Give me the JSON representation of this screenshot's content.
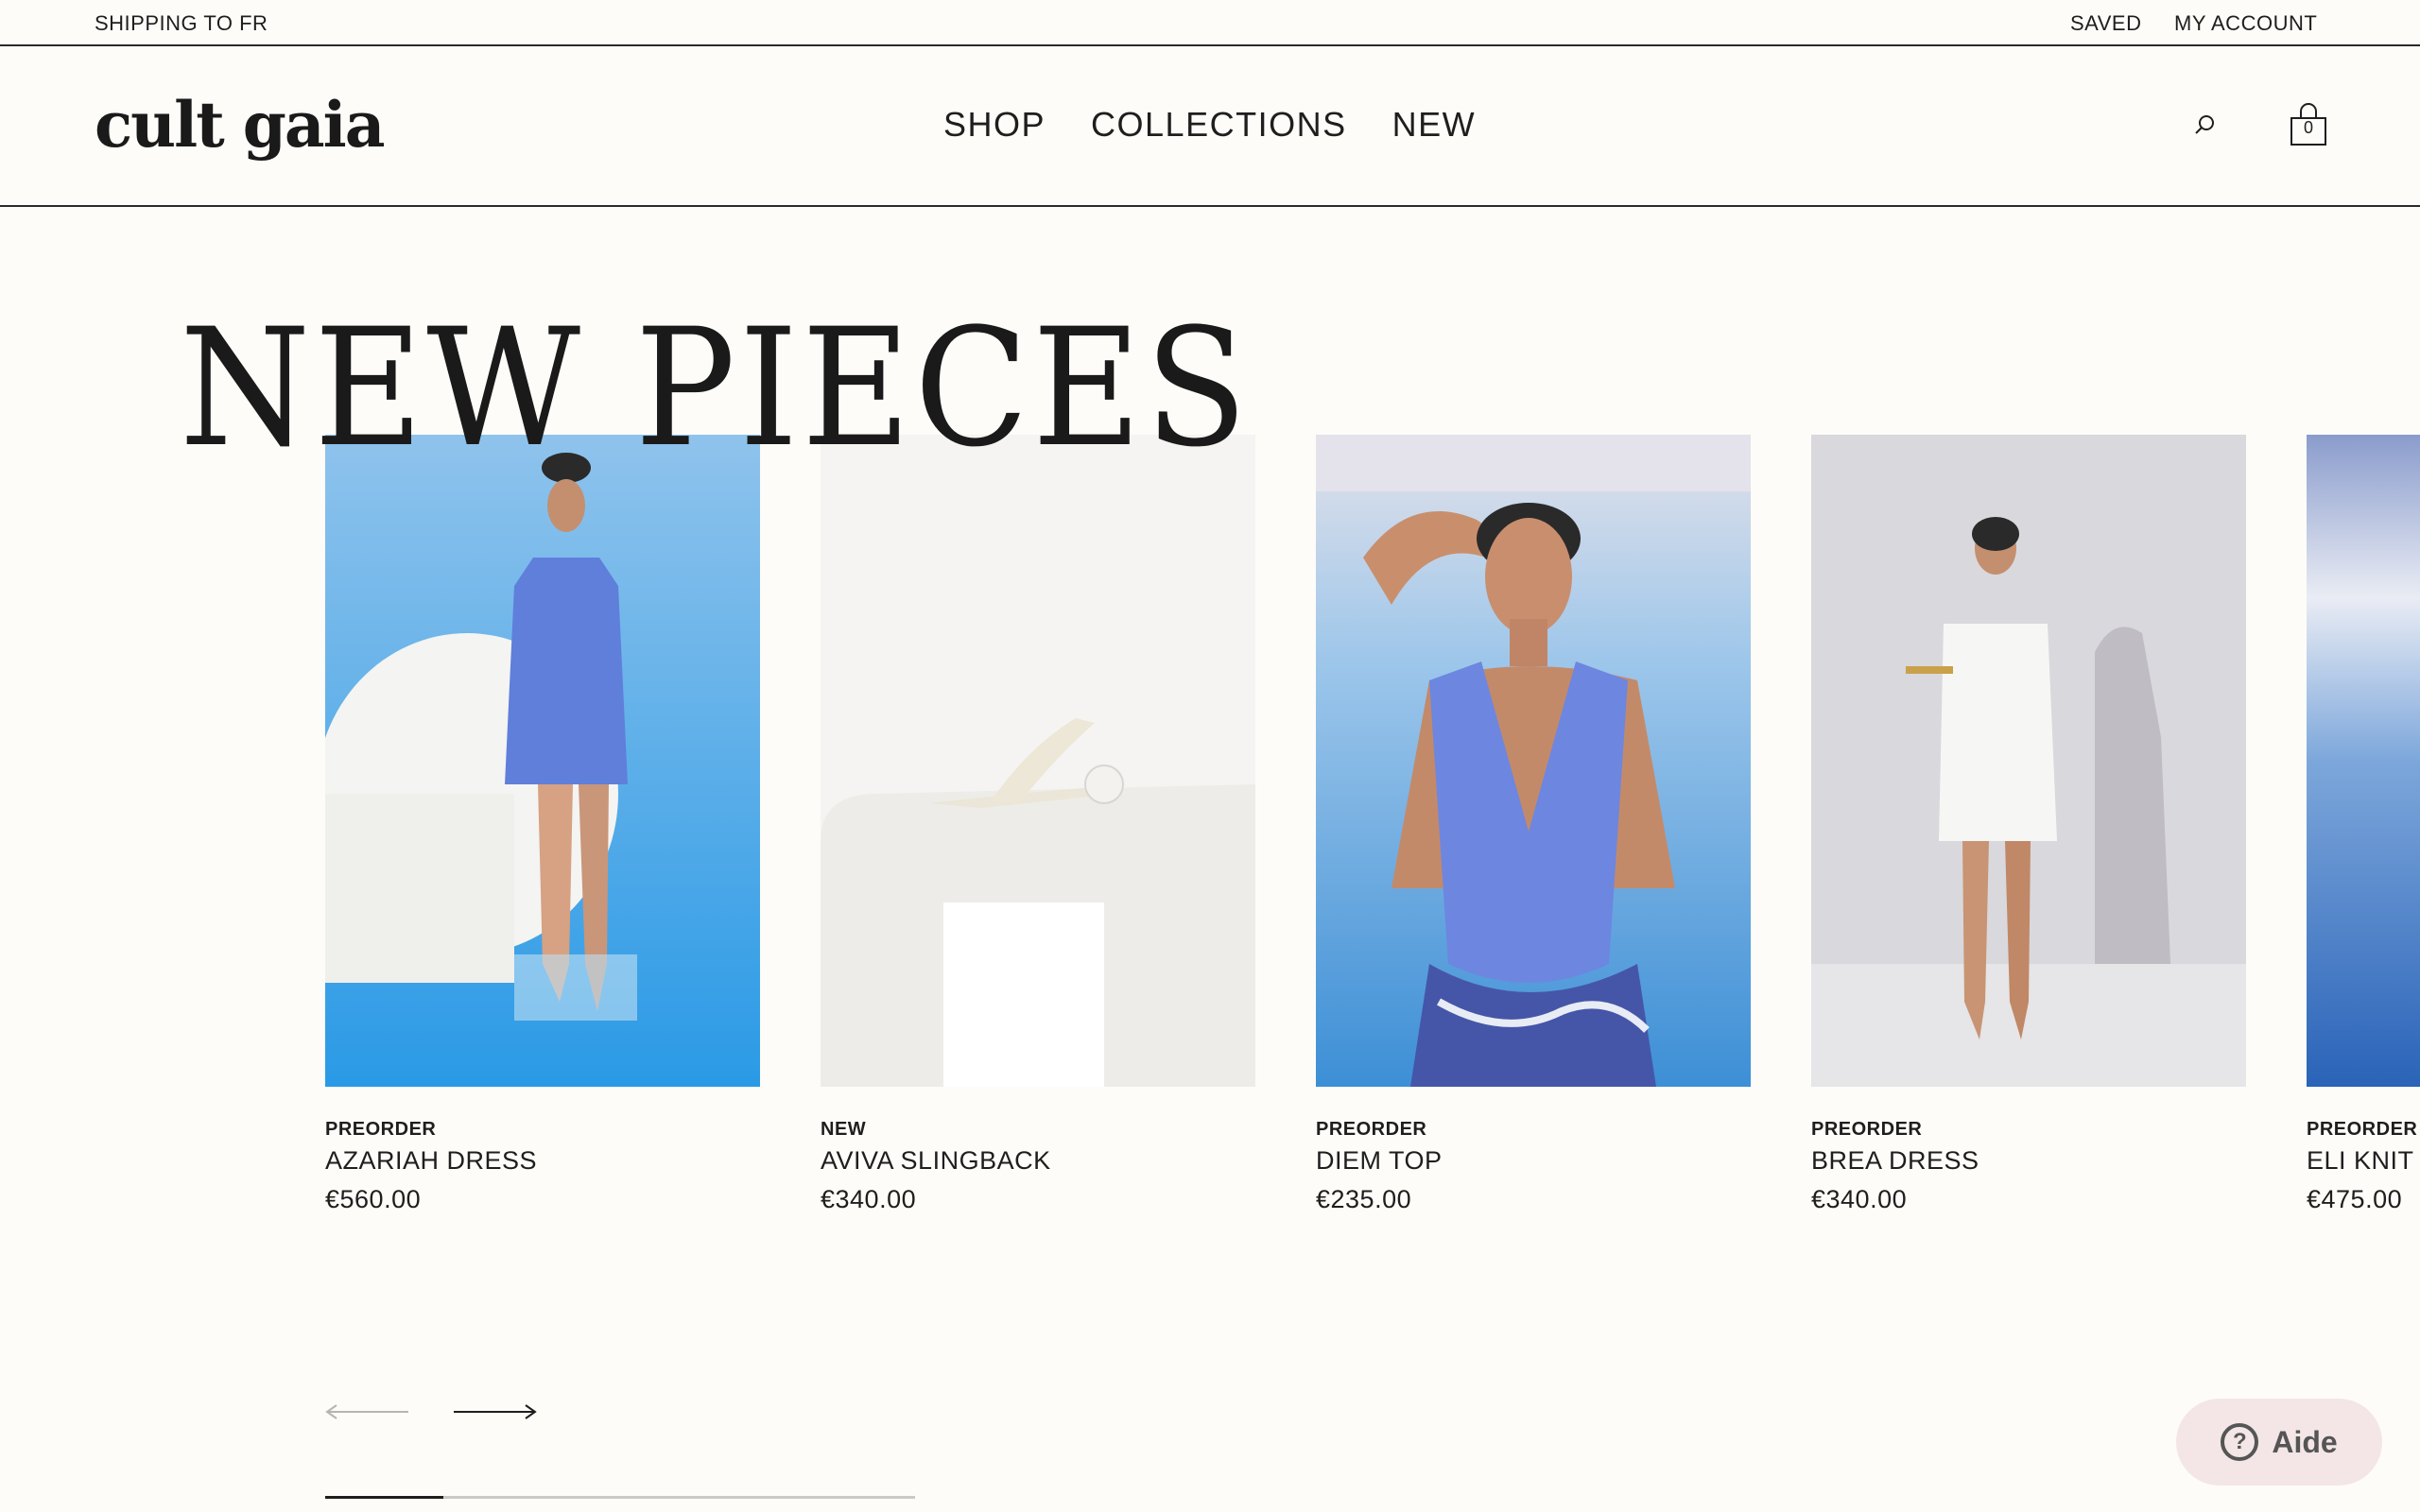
{
  "topbar": {
    "shipping": "SHIPPING TO FR",
    "saved": "SAVED",
    "account": "MY ACCOUNT"
  },
  "header": {
    "logo": "cult gaia",
    "nav": [
      "SHOP",
      "COLLECTIONS",
      "NEW"
    ],
    "bag_count": "0"
  },
  "hero": {
    "title": "NEW PIECES"
  },
  "products": [
    {
      "badge": "PREORDER",
      "name": "AZARIAH DRESS",
      "price": "€560.00"
    },
    {
      "badge": "NEW",
      "name": "AVIVA SLINGBACK",
      "price": "€340.00"
    },
    {
      "badge": "PREORDER",
      "name": "DIEM TOP",
      "price": "€235.00"
    },
    {
      "badge": "PREORDER",
      "name": "BREA DRESS",
      "price": "€340.00"
    },
    {
      "badge": "PREORDER",
      "name": "ELI KNIT I",
      "price": "€475.00"
    }
  ],
  "carousel": {
    "progress": 0.2
  },
  "help": {
    "label": "Aide"
  },
  "colors": {
    "background": "#fdfcf8",
    "text": "#1e1e1e",
    "help_bg": "#f4e6e6"
  }
}
